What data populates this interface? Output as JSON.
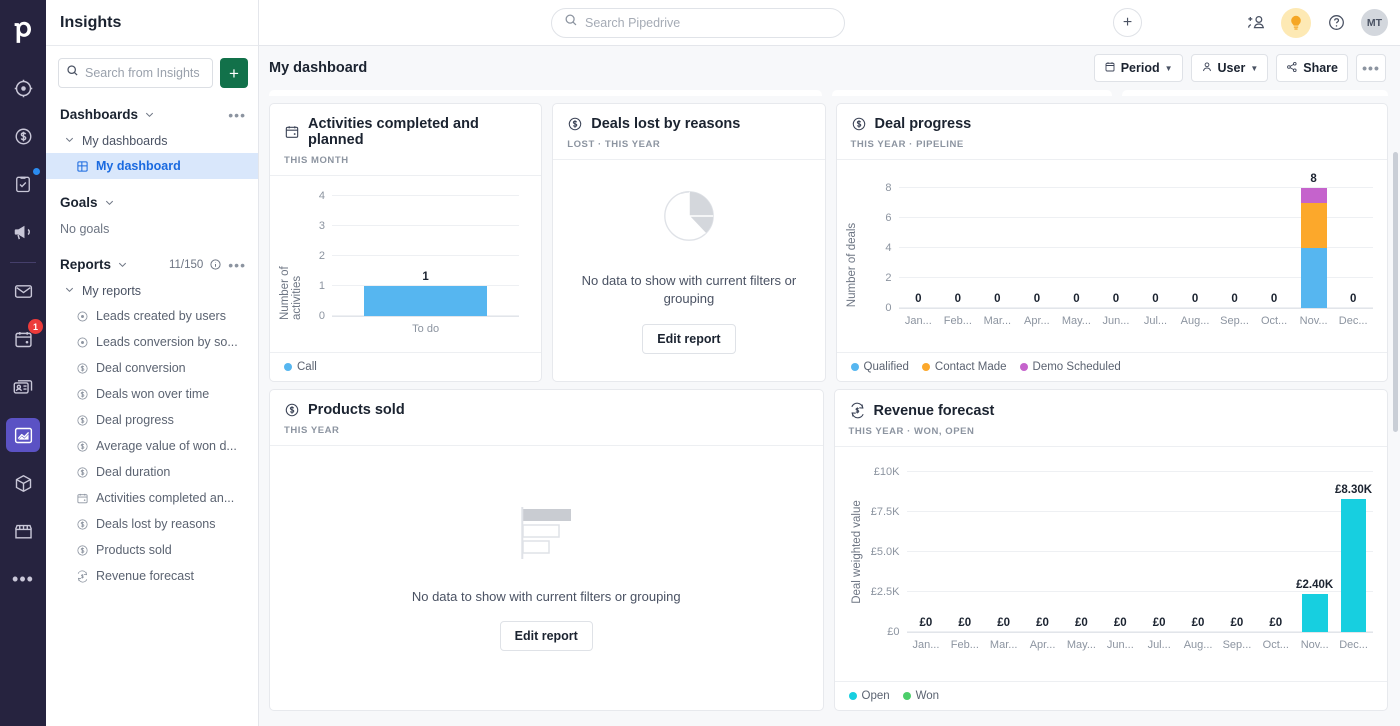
{
  "brand": {
    "logo": "pipedrive-logo",
    "accent": "#5b52c4",
    "green": "#12714a"
  },
  "rail": {
    "items": [
      {
        "name": "leads",
        "icon": "target-icon",
        "badge": null,
        "dot": false,
        "active": false
      },
      {
        "name": "deals",
        "icon": "dollar-circle-icon",
        "badge": null,
        "dot": false,
        "active": false
      },
      {
        "name": "projects",
        "icon": "clipboard-check-icon",
        "badge": null,
        "dot": true,
        "active": false
      },
      {
        "name": "campaigns",
        "icon": "megaphone-icon",
        "badge": null,
        "dot": false,
        "active": false
      },
      {
        "name": "mail",
        "icon": "envelope-icon",
        "badge": null,
        "dot": false,
        "active": false
      },
      {
        "name": "activities",
        "icon": "calendar-icon",
        "badge": "1",
        "dot": false,
        "active": false
      },
      {
        "name": "contacts",
        "icon": "contact-card-icon",
        "badge": null,
        "dot": false,
        "active": false
      },
      {
        "name": "insights",
        "icon": "chart-area-icon",
        "badge": null,
        "dot": false,
        "active": true
      },
      {
        "name": "products",
        "icon": "box-icon",
        "badge": null,
        "dot": false,
        "active": false
      },
      {
        "name": "marketplace",
        "icon": "storefront-icon",
        "badge": null,
        "dot": false,
        "active": false
      },
      {
        "name": "more",
        "icon": "ellipsis-icon",
        "badge": null,
        "dot": false,
        "active": false
      }
    ]
  },
  "panel": {
    "title": "Insights",
    "search": {
      "placeholder": "Search from Insights",
      "value": ""
    },
    "add_label": "+",
    "dashboards": {
      "label": "Dashboards",
      "group_label": "My dashboards",
      "items": [
        {
          "label": "My dashboard",
          "icon": "dashboard-grid-icon",
          "selected": true
        }
      ]
    },
    "goals": {
      "label": "Goals",
      "empty": "No goals"
    },
    "reports": {
      "label": "Reports",
      "count": "11/150",
      "group_label": "My reports",
      "items": [
        {
          "label": "Leads created by users",
          "icon": "target-icon"
        },
        {
          "label": "Leads conversion by so...",
          "icon": "target-icon"
        },
        {
          "label": "Deal conversion",
          "icon": "dollar-circle-icon"
        },
        {
          "label": "Deals won over time",
          "icon": "dollar-circle-icon"
        },
        {
          "label": "Deal progress",
          "icon": "dollar-circle-icon"
        },
        {
          "label": "Average value of won d...",
          "icon": "dollar-circle-icon"
        },
        {
          "label": "Deal duration",
          "icon": "dollar-circle-icon"
        },
        {
          "label": "Activities completed an...",
          "icon": "calendar-icon"
        },
        {
          "label": "Deals lost by reasons",
          "icon": "dollar-circle-icon"
        },
        {
          "label": "Products sold",
          "icon": "dollar-circle-icon"
        },
        {
          "label": "Revenue forecast",
          "icon": "revenue-forecast-icon"
        }
      ]
    }
  },
  "topbar": {
    "search": {
      "placeholder": "Search Pipedrive",
      "value": ""
    },
    "add_label": "+",
    "icons": [
      {
        "name": "add-user-icon"
      },
      {
        "name": "lightbulb-icon"
      },
      {
        "name": "help-circle-icon"
      }
    ],
    "avatar_initials": "MT"
  },
  "dashboard": {
    "title": "My dashboard",
    "actions": [
      {
        "label": "Period",
        "icon": "calendar-icon",
        "caret": true
      },
      {
        "label": "User",
        "icon": "person-icon",
        "caret": true
      },
      {
        "label": "Share",
        "icon": "share-icon",
        "caret": false
      }
    ],
    "more_label": "•••"
  },
  "empty_state": {
    "message": "No data to show with current filters or grouping",
    "button": "Edit report"
  },
  "cards": [
    {
      "id": "activities-completed-and-planned",
      "title": "Activities completed and planned",
      "icon": "calendar-icon",
      "subtitle": "THIS MONTH",
      "legend": [
        {
          "label": "Call",
          "color": "#56b6f0"
        }
      ]
    },
    {
      "id": "deals-lost-by-reasons",
      "title": "Deals lost by reasons",
      "icon": "dollar-circle-icon",
      "subtitle": "LOST  ·  THIS YEAR",
      "legend": []
    },
    {
      "id": "deal-progress",
      "title": "Deal progress",
      "icon": "dollar-circle-icon",
      "subtitle": "THIS YEAR  ·  PIPELINE",
      "legend": [
        {
          "label": "Qualified",
          "color": "#56b6f0"
        },
        {
          "label": "Contact Made",
          "color": "#fca82b"
        },
        {
          "label": "Demo Scheduled",
          "color": "#c563cc"
        }
      ]
    },
    {
      "id": "products-sold",
      "title": "Products sold",
      "icon": "dollar-circle-icon",
      "subtitle": "THIS YEAR",
      "legend": []
    },
    {
      "id": "revenue-forecast",
      "title": "Revenue forecast",
      "icon": "revenue-forecast-icon",
      "subtitle": "THIS YEAR  ·  WON, OPEN",
      "legend": [
        {
          "label": "Open",
          "color": "#17cfe0"
        },
        {
          "label": "Won",
          "color": "#4cce6a"
        }
      ]
    }
  ],
  "chart_data": [
    {
      "id": "activities-completed-and-planned",
      "type": "bar",
      "title": "Activities completed and planned",
      "xlabel": "",
      "ylabel": "Number of activities",
      "categories": [
        "To do"
      ],
      "yticks": [
        "0",
        "1",
        "2",
        "3",
        "4"
      ],
      "ylim": [
        0,
        4
      ],
      "grid": true,
      "legend_position": "bottom",
      "series": [
        {
          "name": "Call",
          "color": "#56b6f0",
          "values": [
            1
          ],
          "labels": [
            "1"
          ]
        }
      ]
    },
    {
      "id": "deals-lost-by-reasons",
      "type": "pie",
      "title": "Deals lost by reasons",
      "empty": true,
      "empty_message": "No data to show with current filters or grouping"
    },
    {
      "id": "deal-progress",
      "type": "bar",
      "stacked": true,
      "title": "Deal progress",
      "xlabel": "",
      "ylabel": "Number of deals",
      "categories": [
        "Jan...",
        "Feb...",
        "Mar...",
        "Apr...",
        "May...",
        "Jun...",
        "Jul...",
        "Aug...",
        "Sep...",
        "Oct...",
        "Nov...",
        "Dec..."
      ],
      "yticks": [
        "0",
        "2",
        "4",
        "6",
        "8"
      ],
      "ylim": [
        0,
        8
      ],
      "grid": true,
      "legend_position": "bottom",
      "totals": [
        "0",
        "0",
        "0",
        "0",
        "0",
        "0",
        "0",
        "0",
        "0",
        "0",
        "8",
        "0"
      ],
      "series": [
        {
          "name": "Qualified",
          "color": "#56b6f0",
          "values": [
            0,
            0,
            0,
            0,
            0,
            0,
            0,
            0,
            0,
            0,
            4,
            0
          ]
        },
        {
          "name": "Contact Made",
          "color": "#fca82b",
          "values": [
            0,
            0,
            0,
            0,
            0,
            0,
            0,
            0,
            0,
            0,
            3,
            0
          ]
        },
        {
          "name": "Demo Scheduled",
          "color": "#c563cc",
          "values": [
            0,
            0,
            0,
            0,
            0,
            0,
            0,
            0,
            0,
            0,
            1,
            0
          ]
        }
      ]
    },
    {
      "id": "products-sold",
      "type": "bar",
      "title": "Products sold",
      "empty": true,
      "empty_message": "No data to show with current filters or grouping"
    },
    {
      "id": "revenue-forecast",
      "type": "bar",
      "title": "Revenue forecast",
      "xlabel": "",
      "ylabel": "Deal weighted value",
      "categories": [
        "Jan...",
        "Feb...",
        "Mar...",
        "Apr...",
        "May...",
        "Jun...",
        "Jul...",
        "Aug...",
        "Sep...",
        "Oct...",
        "Nov...",
        "Dec..."
      ],
      "yticks": [
        "£0",
        "£2.5K",
        "£5.0K",
        "£7.5K",
        "£10K"
      ],
      "ylim": [
        0,
        10000
      ],
      "grid": true,
      "legend_position": "bottom",
      "labels": [
        "£0",
        "£0",
        "£0",
        "£0",
        "£0",
        "£0",
        "£0",
        "£0",
        "£0",
        "£0",
        "£2.40K",
        "£8.30K"
      ],
      "series": [
        {
          "name": "Open",
          "color": "#17cfe0",
          "values": [
            0,
            0,
            0,
            0,
            0,
            0,
            0,
            0,
            0,
            0,
            2400,
            8300
          ]
        },
        {
          "name": "Won",
          "color": "#4cce6a",
          "values": [
            0,
            0,
            0,
            0,
            0,
            0,
            0,
            0,
            0,
            0,
            0,
            0
          ]
        }
      ]
    }
  ]
}
